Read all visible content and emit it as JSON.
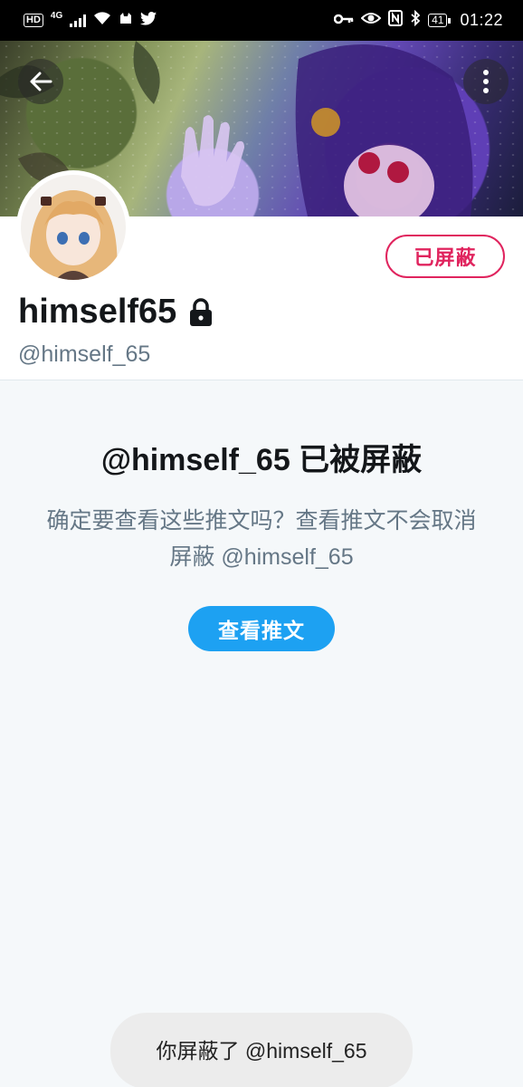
{
  "status_bar": {
    "hd_label": "HD",
    "network_label": "4G",
    "battery_level": "41",
    "time": "01:22"
  },
  "profile": {
    "display_name": "himself65",
    "handle": "@himself_65",
    "blocked_button_label": "已屏蔽",
    "protected_icon": "lock-icon"
  },
  "blocked_notice": {
    "title": "@himself_65 已被屏蔽",
    "body": "确定要查看这些推文吗？查看推文不会取消屏蔽 @himself_65",
    "view_button_label": "查看推文"
  },
  "toast": {
    "message": "你屏蔽了 @himself_65"
  },
  "colors": {
    "accent": "#1da1f2",
    "blocked": "#e0245e",
    "text_primary": "#14171a",
    "text_secondary": "#657786"
  },
  "icons": [
    "back-arrow-icon",
    "more-vertical-icon",
    "lock-icon",
    "key-icon",
    "eye-icon",
    "nfc-icon",
    "bluetooth-icon",
    "wifi-icon",
    "signal-icon",
    "cat-icon",
    "twitter-bird-icon"
  ]
}
